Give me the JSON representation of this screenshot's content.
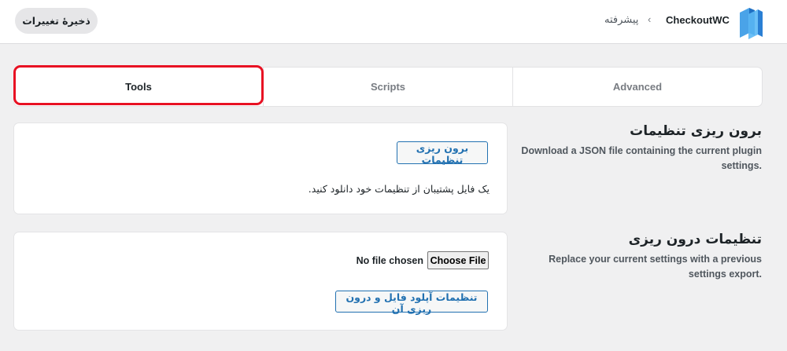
{
  "header": {
    "brand": "CheckoutWC",
    "breadcrumb": "پیشرفته",
    "save_label": "ذخیرهٔ تغییرات",
    "colors": {
      "accent": "#2271b1",
      "highlight": "#e81123"
    }
  },
  "tabs": [
    {
      "label": "Tools",
      "active": true
    },
    {
      "label": "Scripts",
      "active": false
    },
    {
      "label": "Advanced",
      "active": false
    }
  ],
  "export": {
    "title": "برون ریزی تنظیمات",
    "description": "Download a JSON file containing the current plugin settings.",
    "button_label": "برون ریزی تنظیمات",
    "help": "یک فایل پشتیبان از تنظیمات خود دانلود کنید."
  },
  "import": {
    "title": "تنظیمات درون ریزی",
    "description": "Replace your current settings with a previous settings export.",
    "choose_file_label": "Choose File",
    "no_file_text": "No file chosen",
    "button_label": "تنظیمات آپلود فایل و درون ریزی آن"
  }
}
